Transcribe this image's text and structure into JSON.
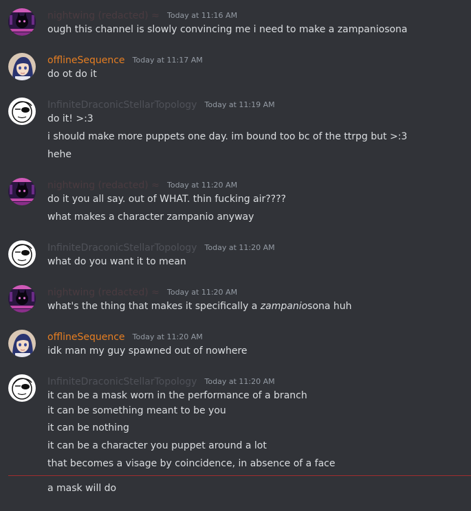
{
  "colors": {
    "background": "#313338",
    "name_orange": "#e67e22",
    "name_dim": "#4a3b40",
    "name_grey": "#4f5158",
    "divider": "#a12d2f",
    "text": "#dbdee1",
    "timestamp": "#949ba4"
  },
  "messages": [
    {
      "author": "nightwing (redacted) ≈",
      "timestamp": "Today at 11:16 AM",
      "avatar_icon": "purple-cat-avatar-icon",
      "lines": [
        "ough this channel is slowly convincing me i need to make a zampaniosona"
      ]
    },
    {
      "author": "offlineSequence",
      "timestamp": "Today at 11:17 AM",
      "avatar_icon": "anime-girl-avatar-icon",
      "lines": [
        "do ot do it"
      ]
    },
    {
      "author": "InfiniteDraconicStellarTopology",
      "timestamp": "Today at 11:19 AM",
      "avatar_icon": "masked-character-avatar-icon",
      "lines": [
        "do it! >:3",
        "i should make more puppets one day. im bound too bc of the ttrpg but >:3",
        "hehe"
      ]
    },
    {
      "author": "nightwing (redacted) ≈",
      "timestamp": "Today at 11:20 AM",
      "avatar_icon": "purple-cat-avatar-icon",
      "lines": [
        "do it you all say. out of WHAT. thin fucking air????",
        "what makes a character zampanio anyway"
      ]
    },
    {
      "author": "InfiniteDraconicStellarTopology",
      "timestamp": "Today at 11:20 AM",
      "avatar_icon": "masked-character-avatar-icon",
      "lines": [
        "what do you want it to mean"
      ]
    },
    {
      "author": "nightwing (redacted) ≈",
      "timestamp": "Today at 11:20 AM",
      "avatar_icon": "purple-cat-avatar-icon",
      "line_pre": "what's the thing that makes it specifically a ",
      "line_em": "zampanio",
      "line_post": "sona huh"
    },
    {
      "author": "offlineSequence",
      "timestamp": "Today at 11:20 AM",
      "avatar_icon": "anime-girl-avatar-icon",
      "lines": [
        "idk man my guy spawned out of nowhere"
      ]
    },
    {
      "author": "InfiniteDraconicStellarTopology",
      "timestamp": "Today at 11:20 AM",
      "avatar_icon": "masked-character-avatar-icon",
      "lines": [
        "it can be a mask worn in the performance of a branch",
        "it can be something meant to be you",
        "it can be nothing",
        "it can be a character you puppet around a lot",
        "that becomes a visage by coincidence, in absence of a face"
      ]
    }
  ],
  "followup": "a mask will do"
}
